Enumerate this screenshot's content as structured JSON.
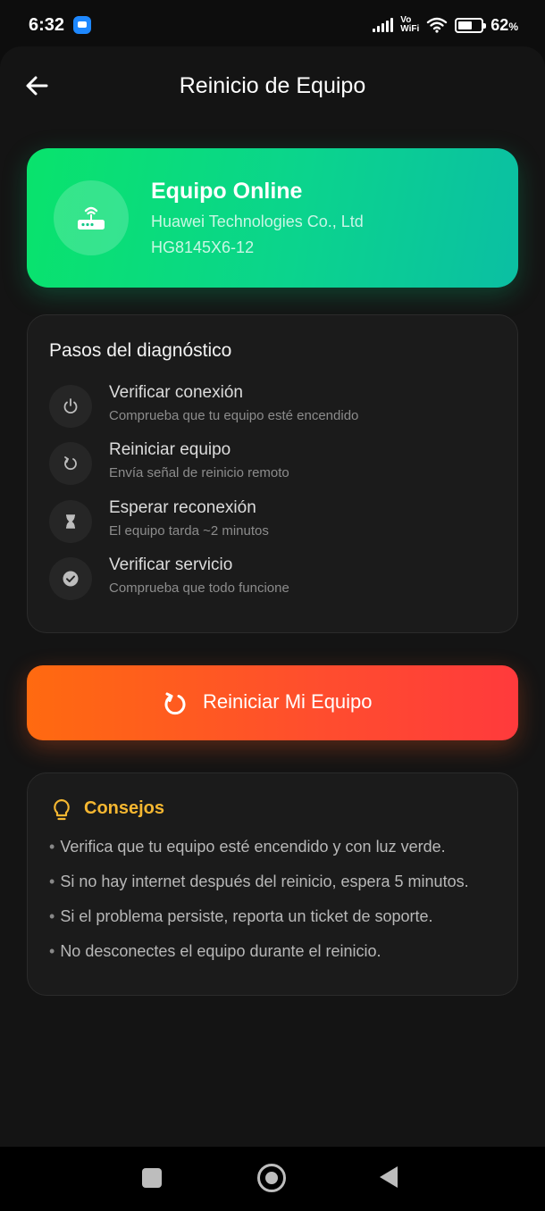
{
  "status_bar": {
    "time": "6:32",
    "vowifi_top": "Vo",
    "vowifi_bottom": "WiFi",
    "battery_level": 0.62,
    "battery_text": "62",
    "battery_unit": "%"
  },
  "header": {
    "title": "Reinicio de Equipo",
    "back_icon": "arrow-left-icon"
  },
  "device": {
    "status": "Equipo Online",
    "brand": "Huawei Technologies Co., Ltd",
    "model": "HG8145X6-12",
    "icon": "router-icon",
    "colors": {
      "gradient_start": "#09e36c",
      "gradient_end": "#0bbfa3"
    }
  },
  "steps": {
    "title": "Pasos del diagnóstico",
    "items": [
      {
        "title": "Verificar conexión",
        "desc": "Comprueba que tu equipo esté encendido",
        "icon": "power-icon"
      },
      {
        "title": "Reiniciar equipo",
        "desc": "Envía señal de reinicio remoto",
        "icon": "restart-icon"
      },
      {
        "title": "Esperar reconexión",
        "desc": "El equipo tarda ~2 minutos",
        "icon": "hourglass-icon"
      },
      {
        "title": "Verificar servicio",
        "desc": "Comprueba que todo funcione",
        "icon": "check-circle-icon"
      }
    ]
  },
  "action": {
    "label": "Reiniciar Mi Equipo",
    "icon": "restart-icon",
    "colors": {
      "gradient_start": "#ff6a10",
      "gradient_end": "#ff3a3c"
    }
  },
  "tips": {
    "title": "Consejos",
    "icon": "lightbulb-icon",
    "accent": "#f5b731",
    "bullet": "•",
    "items": [
      "Verifica que tu equipo esté encendido y con luz verde.",
      "Si no hay internet después del reinicio, espera 5 minutos.",
      "Si el problema persiste, reporta un ticket de soporte.",
      "No desconectes el equipo durante el reinicio."
    ]
  },
  "nav": {
    "recents_icon": "square-icon",
    "home_icon": "home-circle-icon",
    "back_icon": "triangle-back-icon"
  }
}
